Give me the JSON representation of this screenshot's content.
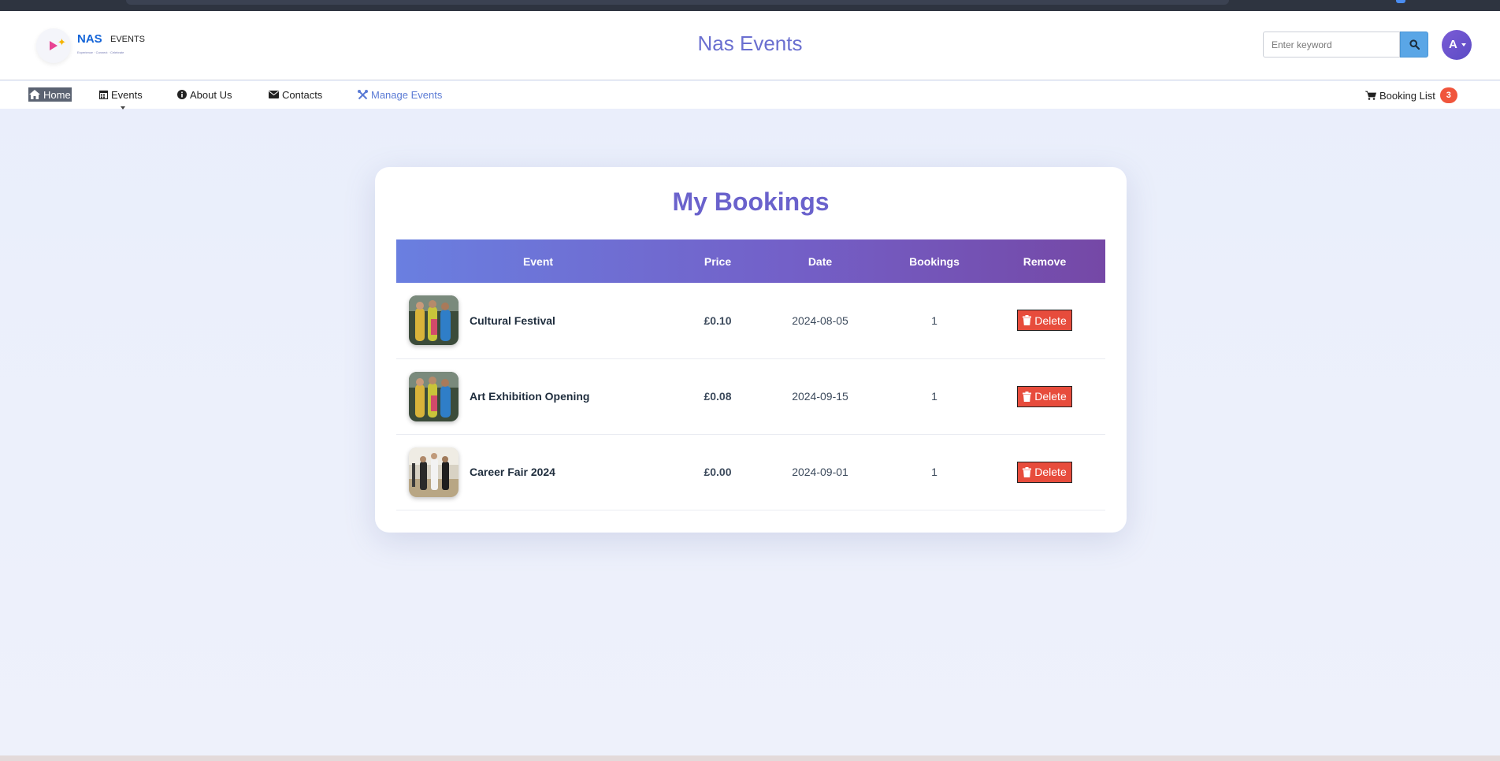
{
  "header": {
    "logo": {
      "brand": "NAS",
      "sub": "EVENTS",
      "tagline": "Experience · Connect · Celebrate"
    },
    "site_title": "Nas Events",
    "search": {
      "placeholder": "Enter keyword",
      "value": ""
    },
    "avatar_letter": "A"
  },
  "nav": {
    "items": [
      {
        "label": "Home",
        "icon": "home-icon"
      },
      {
        "label": "Events",
        "icon": "calendar-icon"
      },
      {
        "label": "About Us",
        "icon": "info-icon"
      },
      {
        "label": "Contacts",
        "icon": "envelope-icon"
      },
      {
        "label": "Manage Events",
        "icon": "tools-icon"
      }
    ],
    "booking_list": {
      "label": "Booking List",
      "count": "3",
      "icon": "cart-icon"
    }
  },
  "bookings": {
    "title": "My Bookings",
    "columns": [
      "Event",
      "Price",
      "Date",
      "Bookings",
      "Remove"
    ],
    "rows": [
      {
        "event": "Cultural Festival",
        "price": "£0.10",
        "date": "2024-08-05",
        "bookings": "1",
        "action": "Delete"
      },
      {
        "event": "Art Exhibition Opening",
        "price": "£0.08",
        "date": "2024-09-15",
        "bookings": "1",
        "action": "Delete"
      },
      {
        "event": "Career Fair 2024",
        "price": "£0.00",
        "date": "2024-09-01",
        "bookings": "1",
        "action": "Delete"
      }
    ]
  },
  "colors": {
    "accent": "#6a62cc",
    "table_header_start": "#6a7fe0",
    "table_header_end": "#7548a6",
    "delete": "#e74c3c",
    "badge": "#f0553c",
    "search_button": "#5aa6e6"
  }
}
